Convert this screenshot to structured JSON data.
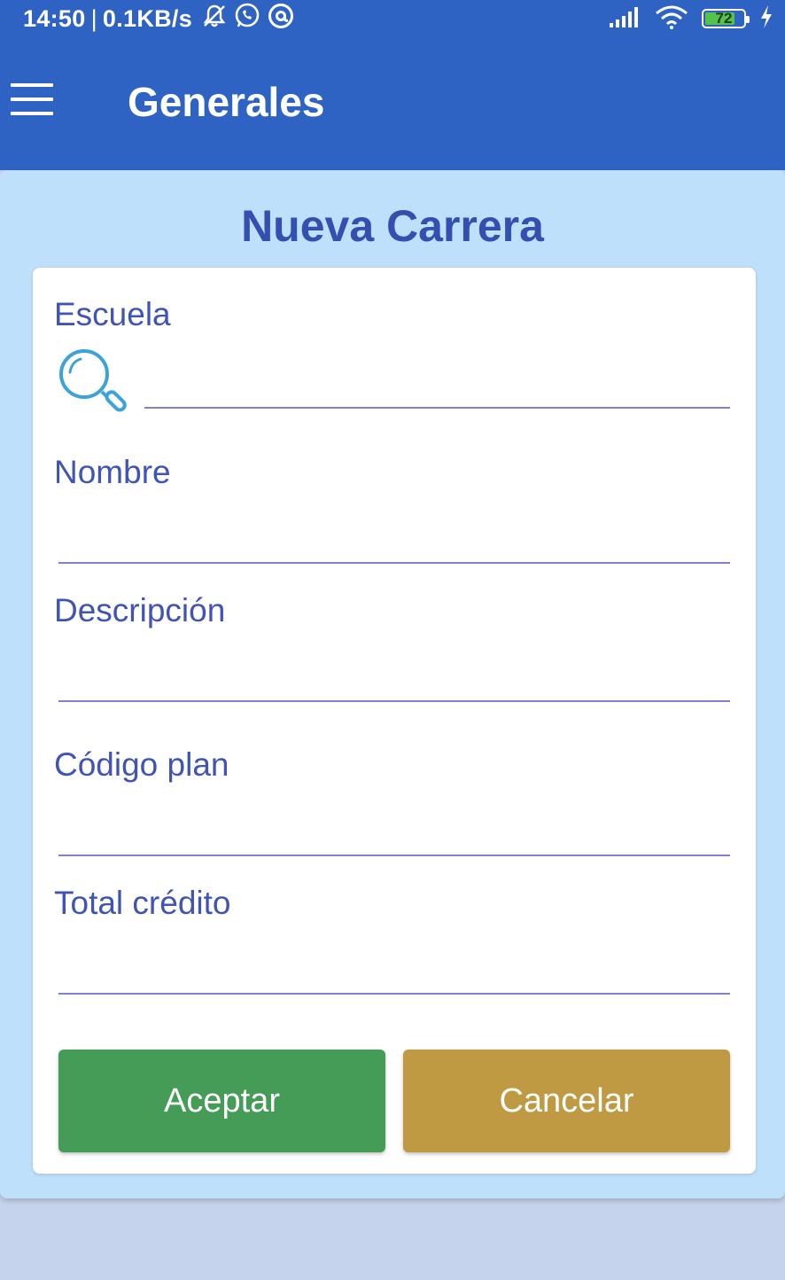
{
  "status_bar": {
    "time": "14:50",
    "separator": "|",
    "net_speed": "0.1KB/s",
    "battery_level": "72",
    "icons": [
      "mute-notification-icon",
      "whatsapp-icon",
      "at-sign-icon",
      "signal-icon",
      "wifi-icon",
      "battery-icon",
      "charging-icon"
    ]
  },
  "app_bar": {
    "title": "Generales",
    "menu_icon": "hamburger-menu-icon"
  },
  "form": {
    "title": "Nueva Carrera",
    "fields": [
      {
        "label": "Escuela",
        "value": "",
        "icon": "search-icon"
      },
      {
        "label": "Nombre",
        "value": ""
      },
      {
        "label": "Descripción",
        "value": ""
      },
      {
        "label": "Código plan",
        "value": ""
      },
      {
        "label": "Total crédito",
        "value": ""
      }
    ],
    "accept_label": "Aceptar",
    "cancel_label": "Cancelar"
  },
  "colors": {
    "app_bar": "#2e63c4",
    "panel_background": "#bfe0fb",
    "label_text": "#4053b6",
    "underline": "#7f7fd6",
    "accept_button": "#449c56",
    "cancel_button": "#bf9a42"
  }
}
